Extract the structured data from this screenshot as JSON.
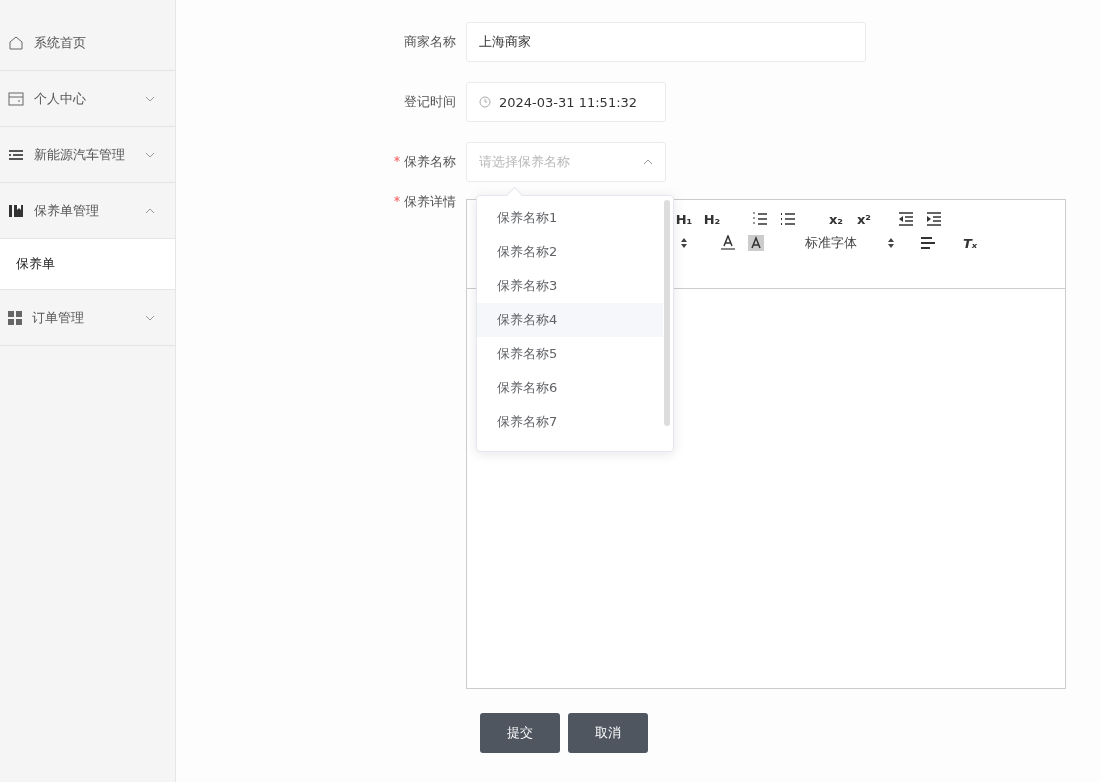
{
  "sidebar": {
    "items": [
      {
        "label": "系统首页",
        "selected": false
      },
      {
        "label": "个人中心",
        "selected": false,
        "expanded": false
      },
      {
        "label": "新能源汽车管理",
        "selected": false,
        "expanded": false
      },
      {
        "label": "保养单管理",
        "selected": false,
        "expanded": true,
        "children": [
          {
            "label": "保养单",
            "selected": true
          }
        ]
      },
      {
        "label": "订单管理",
        "selected": false,
        "expanded": false
      }
    ]
  },
  "form": {
    "fields": [
      {
        "kind": "text",
        "label": "商家名称",
        "required": false,
        "value": "上海商家"
      },
      {
        "kind": "date",
        "label": "登记时间",
        "required": false,
        "value": "2024-03-31 11:51:32"
      },
      {
        "kind": "select",
        "label": "保养名称",
        "required": true,
        "placeholder": "请选择保养名称",
        "open": true,
        "options": [
          {
            "label": "保养名称1",
            "highlighted": false
          },
          {
            "label": "保养名称2",
            "highlighted": false
          },
          {
            "label": "保养名称3",
            "highlighted": false
          },
          {
            "label": "保养名称4",
            "highlighted": true
          },
          {
            "label": "保养名称5",
            "highlighted": false
          },
          {
            "label": "保养名称6",
            "highlighted": false
          },
          {
            "label": "保养名称7",
            "highlighted": false
          }
        ]
      },
      {
        "kind": "editor",
        "label": "保养详情",
        "required": true,
        "font_select": "标准字体",
        "heading_buttons": [
          "H₁",
          "H₂"
        ],
        "script_buttons": [
          "x₂",
          "x²"
        ],
        "clear_button": "Tₓ"
      }
    ],
    "buttons": [
      {
        "label": "提交"
      },
      {
        "label": "取消"
      }
    ]
  }
}
